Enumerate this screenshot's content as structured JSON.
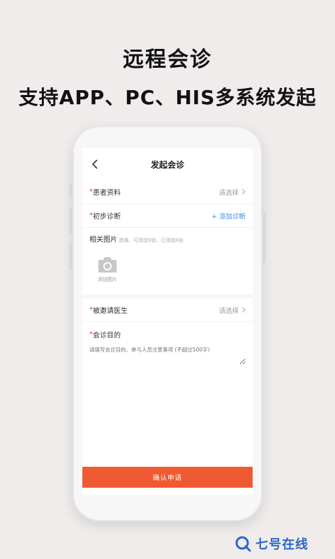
{
  "headline": {
    "line1": "远程会诊",
    "line2": "支持APP、PC、HIS多系统发起"
  },
  "screen": {
    "title": "发起会诊",
    "rows": {
      "patient": {
        "required_mark": "*",
        "label": "患者资料",
        "action": "请选择"
      },
      "diagnosis": {
        "required_mark": "*",
        "label": "初步诊断",
        "action": "+ 添加诊断"
      },
      "doctor": {
        "required_mark": "*",
        "label": "被邀请医生",
        "action": "请选择"
      }
    },
    "photos": {
      "title": "相关图片",
      "hint": "选填，可添加9张，已添加0张",
      "add_label": "添加图片"
    },
    "purpose": {
      "required_mark": "*",
      "title": "会诊目的",
      "placeholder": "请填写会诊目的、参与人员注意事项 (不超过500字)"
    },
    "confirm_label": "确认申请"
  },
  "brand": {
    "name": "七号在线"
  },
  "colors": {
    "accent": "#f05a32",
    "link": "#3a8ee6",
    "required": "#e8412c",
    "brand": "#2a66c9"
  },
  "icons": [
    "back-icon",
    "chevron-right-icon",
    "camera-icon",
    "brand-logo-icon"
  ]
}
